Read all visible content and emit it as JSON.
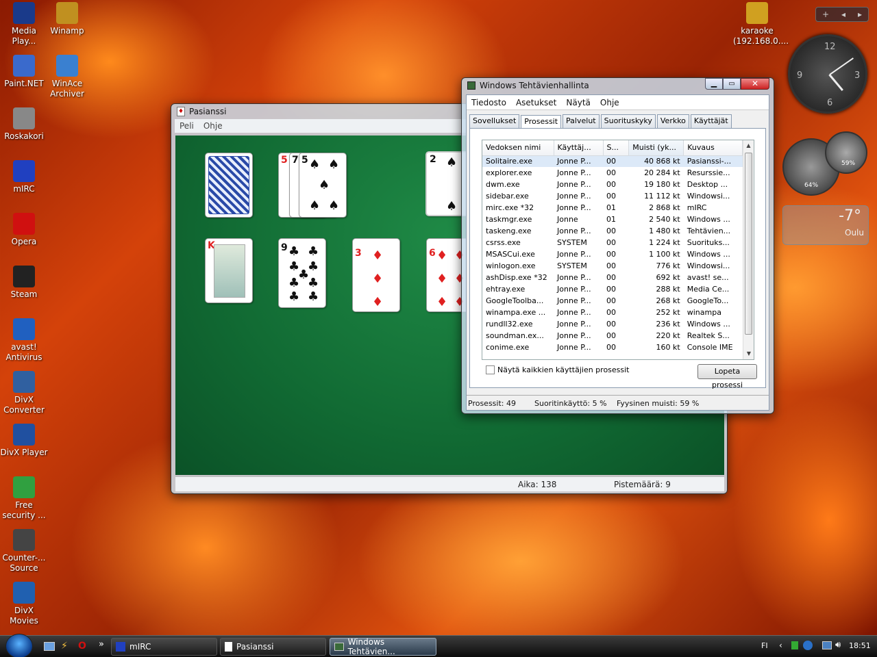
{
  "desktop_icons": [
    {
      "label": "Media Play...",
      "icon": "media-player-icon",
      "color": "#1a3a8a"
    },
    {
      "label": "Winamp",
      "icon": "winamp-icon",
      "color": "#c09020"
    },
    {
      "label": "Paint.NET",
      "icon": "paintnet-icon",
      "color": "#3a6acc"
    },
    {
      "label": "WinAce Archiver",
      "icon": "winace-icon",
      "color": "#3a80d0"
    },
    {
      "label": "Roskakori",
      "icon": "recycle-bin-icon",
      "color": "#888"
    },
    {
      "label": "mIRC",
      "icon": "mirc-icon",
      "color": "#2040c0"
    },
    {
      "label": "Opera",
      "icon": "opera-icon",
      "color": "#d01010"
    },
    {
      "label": "Steam",
      "icon": "steam-icon",
      "color": "#222"
    },
    {
      "label": "avast! Antivirus",
      "icon": "avast-icon",
      "color": "#2060c0"
    },
    {
      "label": "DivX Converter",
      "icon": "divx-converter-icon",
      "color": "#3060a0"
    },
    {
      "label": "DivX Player",
      "icon": "divx-player-icon",
      "color": "#2050a0"
    },
    {
      "label": "Free security ...",
      "icon": "security-icon",
      "color": "#30a040"
    },
    {
      "label": "Counter-... Source",
      "icon": "counter-strike-icon",
      "color": "#444"
    },
    {
      "label": "DivX Movies",
      "icon": "divx-movies-icon",
      "color": "#2060b0"
    },
    {
      "label": "karaoke (192.168.0....",
      "icon": "network-folder-icon",
      "color": "#d0a020"
    }
  ],
  "solitaire": {
    "title": "Pasianssi",
    "menu": [
      "Peli",
      "Ohje"
    ],
    "status_time": "Aika: 138",
    "status_score": "Pistemäärä: 9",
    "top_row": [
      {
        "label": "5",
        "sub": "7",
        "sub2": "5",
        "suit": "♠",
        "color": "blk"
      },
      {
        "label": "2",
        "suit": "♠",
        "color": "blk"
      }
    ],
    "tableau": [
      {
        "rank": "K",
        "suit": "♦",
        "color": "red"
      },
      {
        "rank": "9",
        "suit": "♣",
        "color": "blk"
      },
      {
        "rank": "3",
        "suit": "♦",
        "color": "red"
      },
      {
        "rank": "6",
        "suit": "♦",
        "color": "red"
      }
    ]
  },
  "taskmgr": {
    "title": "Windows Tehtävienhallinta",
    "menu": [
      "Tiedosto",
      "Asetukset",
      "Näytä",
      "Ohje"
    ],
    "tabs": [
      "Sovellukset",
      "Prosessit",
      "Palvelut",
      "Suorituskyky",
      "Verkko",
      "Käyttäjät"
    ],
    "active_tab": "Prosessit",
    "columns": [
      "Vedoksen nimi",
      "Käyttäj...",
      "S...",
      "Muisti (yk...",
      "Kuvaus"
    ],
    "rows": [
      [
        "Solitaire.exe",
        "Jonne P...",
        "00",
        "40 868 kt",
        "Pasianssi-..."
      ],
      [
        "explorer.exe",
        "Jonne P...",
        "00",
        "20 284 kt",
        "Resurssie..."
      ],
      [
        "dwm.exe",
        "Jonne P...",
        "00",
        "19 180 kt",
        "Desktop ..."
      ],
      [
        "sidebar.exe",
        "Jonne P...",
        "00",
        "11 112 kt",
        "Windowsi..."
      ],
      [
        "mirc.exe *32",
        "Jonne P...",
        "01",
        "2 868 kt",
        "mIRC"
      ],
      [
        "taskmgr.exe",
        "Jonne",
        "01",
        "2 540 kt",
        "Windows ..."
      ],
      [
        "taskeng.exe",
        "Jonne P...",
        "00",
        "1 480 kt",
        "Tehtävien..."
      ],
      [
        "csrss.exe",
        "SYSTEM",
        "00",
        "1 224 kt",
        "Suorituks..."
      ],
      [
        "MSASCui.exe",
        "Jonne P...",
        "00",
        "1 100 kt",
        "Windows ..."
      ],
      [
        "winlogon.exe",
        "SYSTEM",
        "00",
        "776 kt",
        "Windowsi..."
      ],
      [
        "ashDisp.exe *32",
        "Jonne P...",
        "00",
        "692 kt",
        "avast! se..."
      ],
      [
        "ehtray.exe",
        "Jonne P...",
        "00",
        "288 kt",
        "Media Ce..."
      ],
      [
        "GoogleToolba...",
        "Jonne P...",
        "00",
        "268 kt",
        "GoogleTo..."
      ],
      [
        "winampa.exe ...",
        "Jonne P...",
        "00",
        "252 kt",
        "winampa"
      ],
      [
        "rundll32.exe",
        "Jonne P...",
        "00",
        "236 kt",
        "Windows ..."
      ],
      [
        "soundman.ex...",
        "Jonne P...",
        "00",
        "220 kt",
        "Realtek S..."
      ],
      [
        "conime.exe",
        "Jonne P...",
        "00",
        "160 kt",
        "Console IME"
      ]
    ],
    "checkbox_label": "Näytä kaikkien käyttäjien prosessit",
    "end_button": "Lopeta prosessi",
    "status_processes": "Prosessit: 49",
    "status_cpu": "Suoritinkäyttö: 5 %",
    "status_memory": "Fyysinen muisti: 59 %"
  },
  "sidebar": {
    "weather_temp": "-7°",
    "weather_city": "Oulu",
    "cpu_pct": "64%",
    "ram_pct": "59%",
    "clock_numbers": [
      "12",
      "3",
      "6",
      "9"
    ]
  },
  "taskbar": {
    "buttons": [
      {
        "label": "mIRC"
      },
      {
        "label": "Pasianssi"
      },
      {
        "label": "Windows Tehtävien..."
      }
    ],
    "lang": "FI",
    "time": "18:51",
    "overflow": "»"
  }
}
